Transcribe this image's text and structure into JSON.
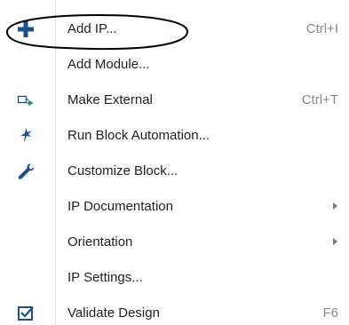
{
  "menu": {
    "items": [
      {
        "label": "Add IP...",
        "shortcut": "Ctrl+I",
        "icon": "add-plus-icon"
      },
      {
        "label": "Add Module...",
        "shortcut": "",
        "icon": ""
      },
      {
        "label": "Make External",
        "shortcut": "Ctrl+T",
        "icon": "make-external-icon"
      },
      {
        "label": "Run Block Automation...",
        "shortcut": "",
        "icon": "block-automation-icon"
      },
      {
        "label": "Customize Block...",
        "shortcut": "",
        "icon": "wrench-icon"
      },
      {
        "label": "IP Documentation",
        "shortcut": "",
        "icon": "",
        "submenu": true
      },
      {
        "label": "Orientation",
        "shortcut": "",
        "icon": "",
        "submenu": true
      },
      {
        "label": "IP Settings...",
        "shortcut": "",
        "icon": ""
      },
      {
        "label": "Validate Design",
        "shortcut": "F6",
        "icon": "validate-check-icon"
      }
    ]
  },
  "colors": {
    "icon_blue": "#1c4f8c",
    "icon_teal": "#2a8a7a",
    "shortcut_gray": "#8a8a8a",
    "annotation_black": "#000000"
  }
}
